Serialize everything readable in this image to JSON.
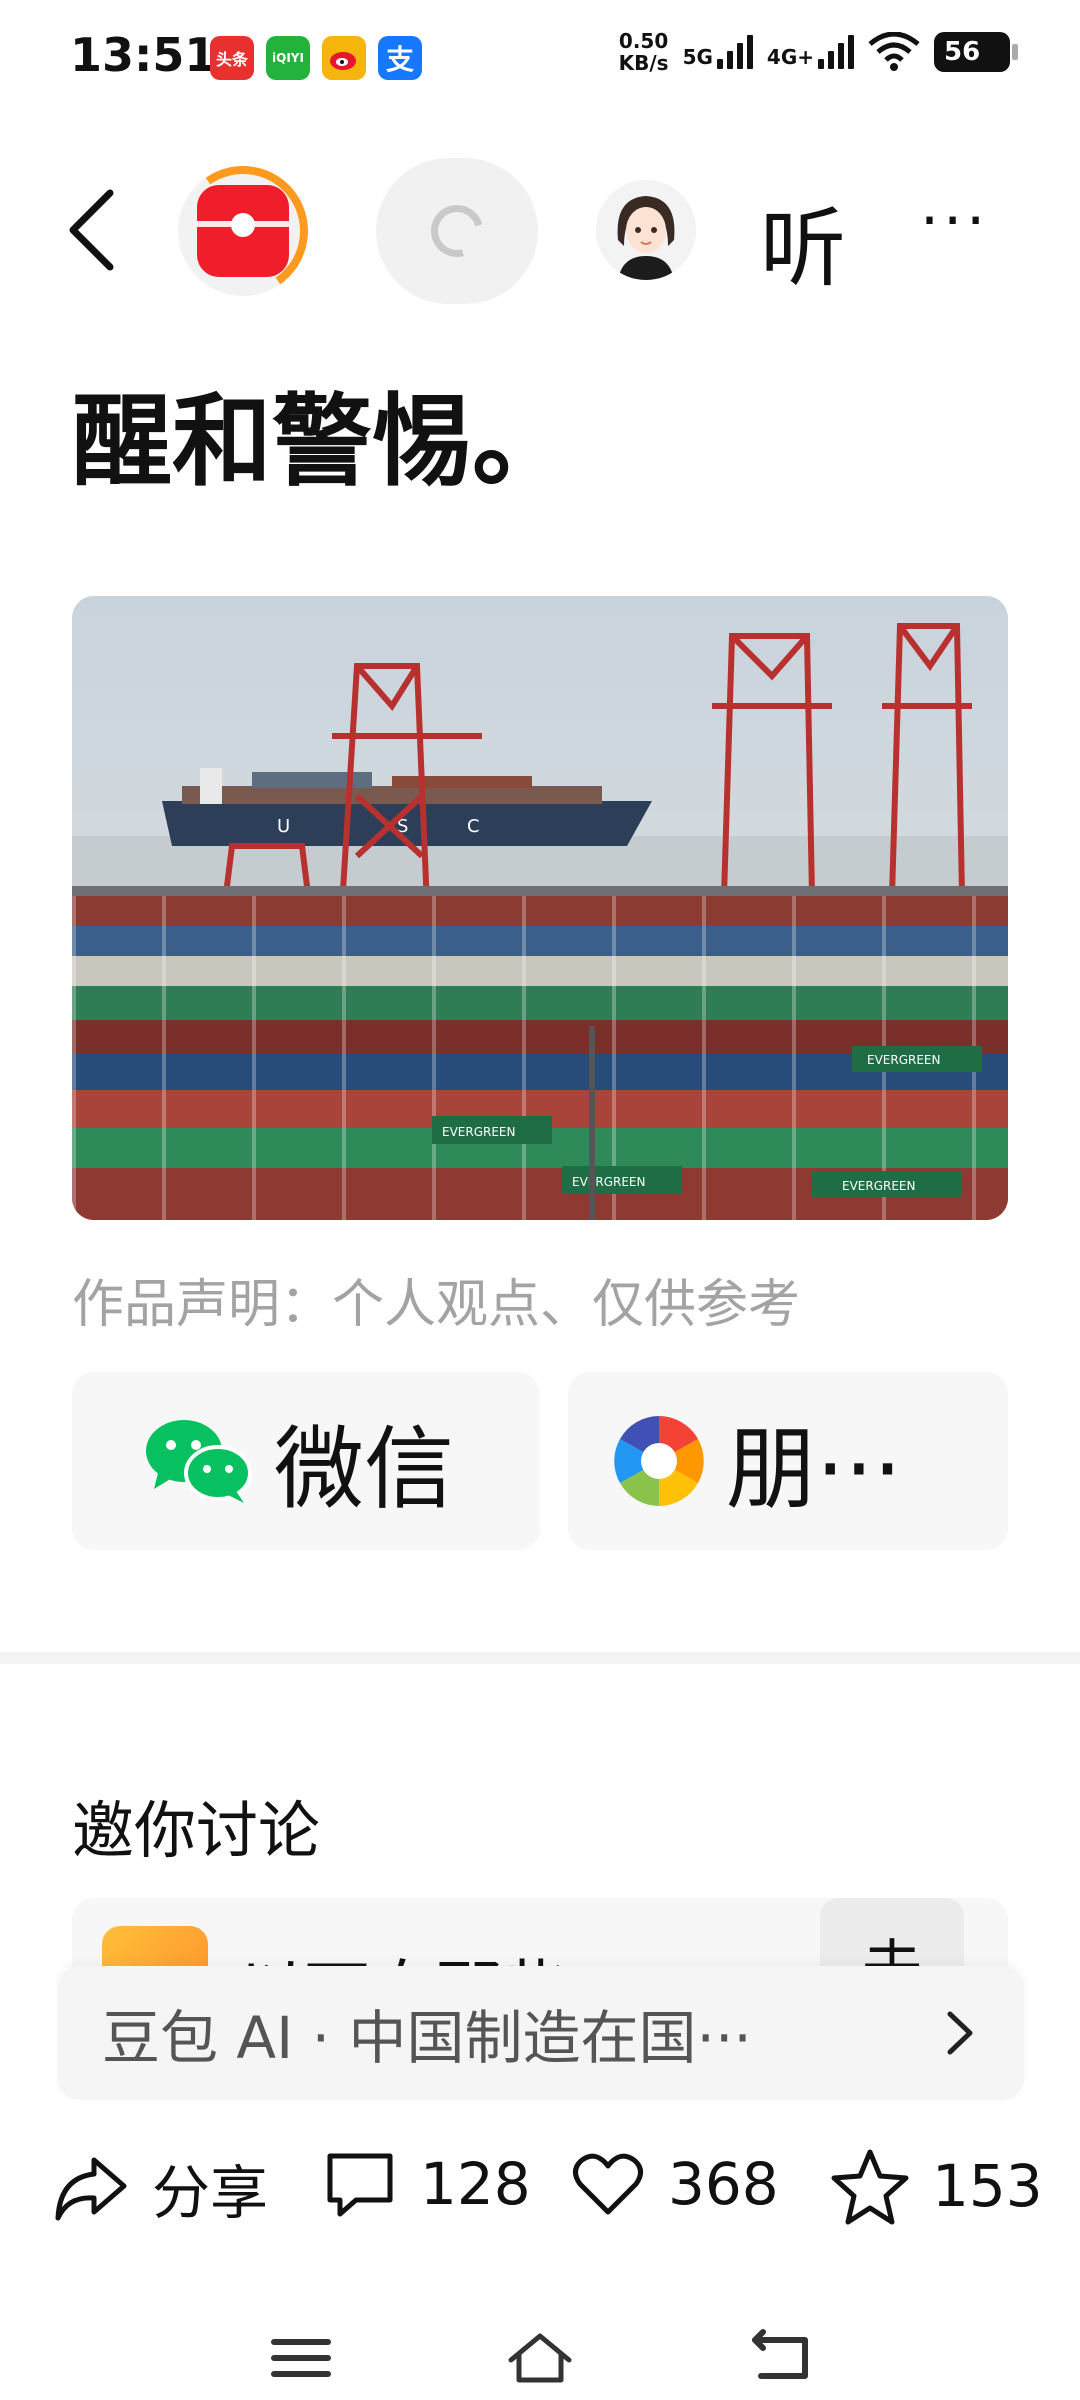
{
  "status_bar": {
    "time": "13:51",
    "app_icons": [
      {
        "name": "toutiao-icon",
        "label": "头条",
        "color": "#e8312e"
      },
      {
        "name": "iqiyi-icon",
        "label": "iQIYI",
        "color": "#23b33c"
      },
      {
        "name": "weibo-icon",
        "label": "",
        "color": "#f5b50c"
      },
      {
        "name": "alipay-icon",
        "label": "支",
        "color": "#1677ff"
      }
    ],
    "speed_value": "0.50",
    "speed_unit": "KB/s",
    "net_5g": "5G",
    "net_4g": "4G+",
    "battery": "56"
  },
  "top_nav": {
    "listen_label": "听",
    "more_label": "···"
  },
  "article": {
    "headline": "醒和警惕。",
    "statement": "作品声明：个人观点、仅供参考"
  },
  "share": {
    "wechat_label": "微信",
    "moments_label": "朋···"
  },
  "discussion": {
    "title": "邀你讨论",
    "item_text": "以下自那些",
    "side_text": "去"
  },
  "ai_bar": {
    "text": "豆包 AI · 中国制造在国···"
  },
  "actions": {
    "share_label": "分享",
    "comments": "128",
    "likes": "368",
    "favorites": "153"
  },
  "colors": {
    "accent_red": "#f01d2a",
    "wechat_green": "#07c160",
    "ring_orange": "#ff9a1f"
  }
}
